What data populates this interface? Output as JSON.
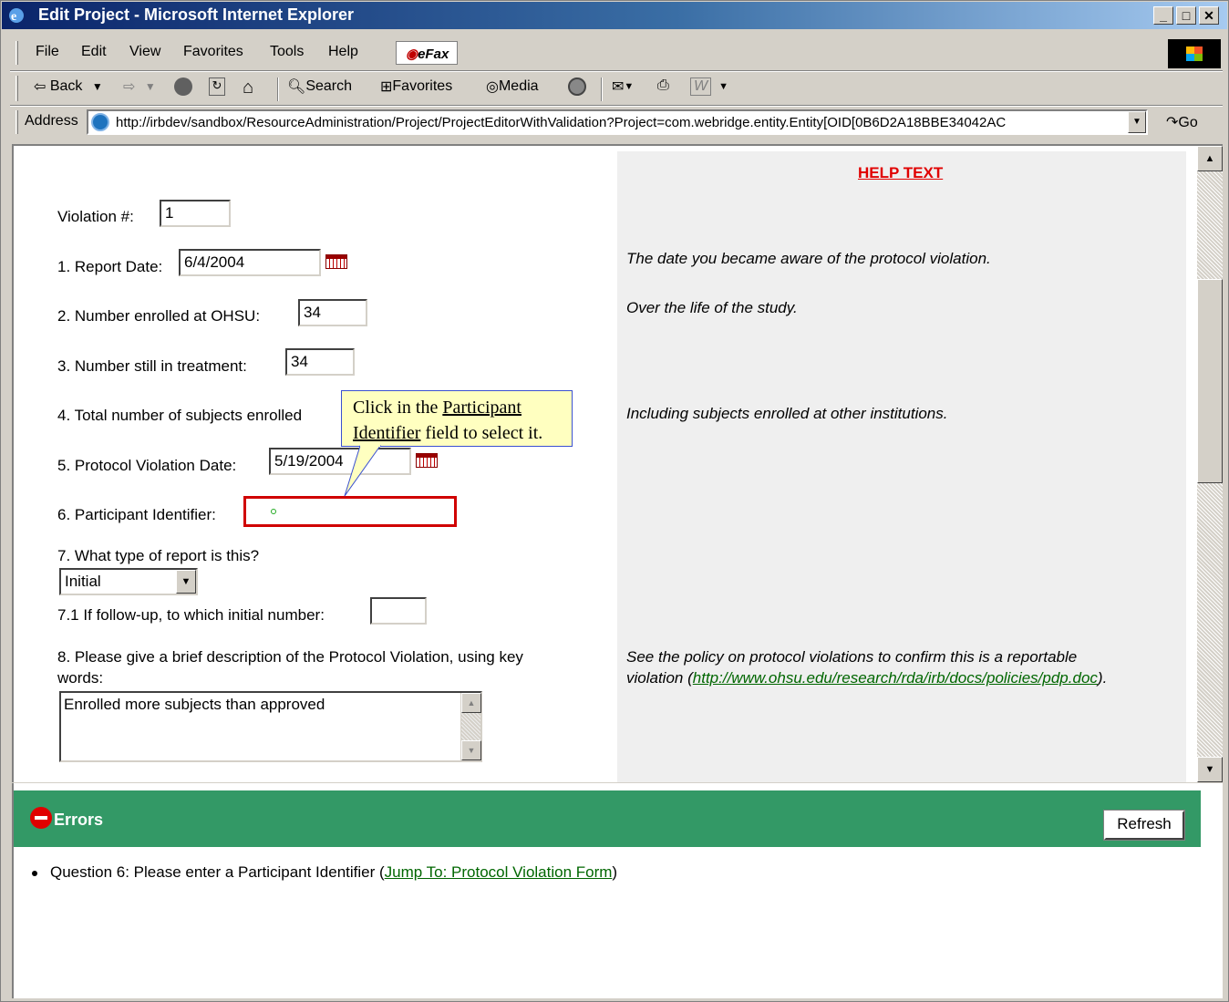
{
  "window": {
    "title": "Edit Project - Microsoft Internet Explorer",
    "min": "_",
    "max": "□",
    "close": "✕"
  },
  "menu": {
    "items": [
      "File",
      "Edit",
      "View",
      "Favorites",
      "Tools",
      "Help"
    ],
    "efax": "eFax"
  },
  "toolbar": {
    "back": "Back",
    "search": "Search",
    "favorites": "Favorites",
    "media": "Media"
  },
  "address": {
    "label": "Address",
    "url": "http://irbdev/sandbox/ResourceAdministration/Project/ProjectEditorWithValidation?Project=com.webridge.entity.Entity[OID[0B6D2A18BBE34042AC",
    "go": "Go"
  },
  "help": {
    "title": "HELP TEXT",
    "report_date": "The date you became aware of the protocol violation.",
    "enrolled": "Over the life of the study.",
    "total": "Including subjects enrolled at other institutions.",
    "desc_line1": "See the policy on protocol violations to confirm this is a reportable",
    "desc_line2_pre": "violation (",
    "desc_link": "http://www.ohsu.edu/research/rda/irb/docs/policies/pdp.doc",
    "desc_line2_post": ")."
  },
  "form": {
    "violation_label": "Violation #:",
    "violation_value": "1",
    "q1_label": "1. Report Date:",
    "q1_value": "6/4/2004",
    "q2_label": "2.  Number enrolled at OHSU:",
    "q2_value": "34",
    "q3_label": "3.  Number still in treatment:",
    "q3_value": "34",
    "q4_label": "4.  Total number of subjects enrolled",
    "q5_label": "5.  Protocol Violation Date:",
    "q5_value": "5/19/2004",
    "q6_label": "6.  Participant Identifier:",
    "q7_label": "7. What type of report is this?",
    "q7_value": "Initial",
    "q71_label": "7.1  If follow-up, to which initial number:",
    "q8_label_line1": "8.  Please give a brief description of the Protocol Violation, using key",
    "q8_label_line2": "words:",
    "q8_value": "Enrolled more subjects than approved"
  },
  "tooltip": {
    "line1_pre": "Click in the ",
    "line1_u": "Participant",
    "line2_u": "Identifier",
    "line2_post": " field to select it."
  },
  "errors": {
    "title": "Errors",
    "refresh": "Refresh",
    "message": "Question 6: Please enter a Participant Identifier (",
    "link": "Jump To: Protocol Violation Form",
    "close_paren": ")"
  }
}
